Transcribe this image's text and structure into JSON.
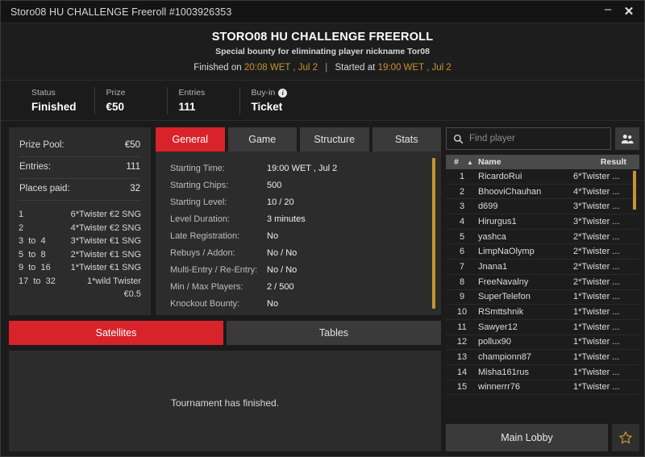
{
  "window": {
    "title": "Storo08 HU CHALLENGE Freeroll #1003926353",
    "minimize_label": "–",
    "close_label": "✕"
  },
  "header": {
    "title": "STORO08 HU CHALLENGE FREEROLL",
    "subtitle": "Special bounty for eliminating player nickname Tor08",
    "finished_label": "Finished on",
    "finished_time": "20:08 WET , Jul 2",
    "separator": "|",
    "started_label": "Started at",
    "started_time": "19:00 WET , Jul 2"
  },
  "status": {
    "cells": [
      {
        "label": "Status",
        "value": "Finished"
      },
      {
        "label": "Prize",
        "value": "€50"
      },
      {
        "label": "Entries",
        "value": "111"
      },
      {
        "label": "Buy-in",
        "value": "Ticket",
        "icon": "info-icon",
        "icon_glyph": "i"
      }
    ]
  },
  "prize_pool": {
    "rows": [
      {
        "label": "Prize Pool:",
        "value": "€50"
      },
      {
        "label": "Entries:",
        "value": "111"
      },
      {
        "label": "Places paid:",
        "value": "32"
      }
    ],
    "payouts": [
      {
        "range": "1",
        "prize": "6*Twister €2 SNG"
      },
      {
        "range": "2",
        "prize": "4*Twister €2 SNG"
      },
      {
        "range": "3  to  4",
        "prize": "3*Twister €1 SNG"
      },
      {
        "range": "5  to  8",
        "prize": "2*Twister €1 SNG"
      },
      {
        "range": "9  to  16",
        "prize": "1*Twister €1 SNG"
      },
      {
        "range": "17  to  32",
        "prize": "1*wild Twister €0.5"
      }
    ]
  },
  "tabs": [
    {
      "label": "General",
      "active": true
    },
    {
      "label": "Game",
      "active": false
    },
    {
      "label": "Structure",
      "active": false
    },
    {
      "label": "Stats",
      "active": false
    }
  ],
  "general": {
    "rows": [
      {
        "key": "Starting Time:",
        "value": "19:00 WET , Jul 2"
      },
      {
        "key": "Starting Chips:",
        "value": "500"
      },
      {
        "key": "Starting Level:",
        "value": "10 / 20"
      },
      {
        "key": "Level Duration:",
        "value": "3 minutes"
      },
      {
        "key": "Late Registration:",
        "value": "No"
      },
      {
        "key": "Rebuys / Addon:",
        "value": "No / No"
      },
      {
        "key": "Multi-Entry / Re-Entry:",
        "value": "No / No"
      },
      {
        "key": "Min / Max Players:",
        "value": "2 / 500"
      },
      {
        "key": "Knockout Bounty:",
        "value": "No"
      }
    ]
  },
  "sat_tabs": [
    {
      "label": "Satellites",
      "active": true
    },
    {
      "label": "Tables",
      "active": false
    }
  ],
  "sat_body": {
    "message": "Tournament has finished."
  },
  "search": {
    "placeholder": "Find player",
    "value": "",
    "icon": "search-icon",
    "people_icon": "people-icon"
  },
  "players": {
    "columns": {
      "num": "#",
      "sort": "▲",
      "name": "Name",
      "result": "Result"
    },
    "rows": [
      {
        "num": "1",
        "name": "RicardoRui",
        "result": "6*Twister ..."
      },
      {
        "num": "2",
        "name": "BhooviChauhan",
        "result": "4*Twister ..."
      },
      {
        "num": "3",
        "name": "d699",
        "result": "3*Twister ..."
      },
      {
        "num": "4",
        "name": "Hirurgus1",
        "result": "3*Twister ..."
      },
      {
        "num": "5",
        "name": "yashca",
        "result": "2*Twister ..."
      },
      {
        "num": "6",
        "name": "LimpNaOlymp",
        "result": "2*Twister ..."
      },
      {
        "num": "7",
        "name": "Jnana1",
        "result": "2*Twister ..."
      },
      {
        "num": "8",
        "name": "FreeNavalny",
        "result": "2*Twister ..."
      },
      {
        "num": "9",
        "name": "SuperTelefon",
        "result": "1*Twister ..."
      },
      {
        "num": "10",
        "name": "RSmttshnik",
        "result": "1*Twister ..."
      },
      {
        "num": "11",
        "name": "Sawyer12",
        "result": "1*Twister ..."
      },
      {
        "num": "12",
        "name": "pollux90",
        "result": "1*Twister ..."
      },
      {
        "num": "13",
        "name": "championn87",
        "result": "1*Twister ..."
      },
      {
        "num": "14",
        "name": "Misha161rus",
        "result": "1*Twister ..."
      },
      {
        "num": "15",
        "name": "winnerrr76",
        "result": "1*Twister ..."
      }
    ]
  },
  "footer": {
    "main_lobby": "Main Lobby",
    "favorite_icon": "star-icon"
  },
  "colors": {
    "accent_red": "#d8232a",
    "amber": "#c8942f",
    "panel": "#2c2c2c",
    "window_bg": "#1b1b1b"
  }
}
